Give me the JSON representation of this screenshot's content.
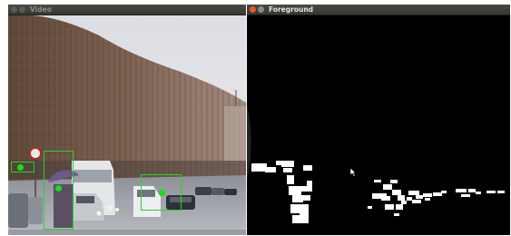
{
  "windows": {
    "video": {
      "title": "Video",
      "title_color": "#8f8d86",
      "close_color": "#5c5b55",
      "min_color": "#5c5b55"
    },
    "foreground": {
      "title": "Foreground",
      "title_color": "#e6e4df",
      "close_color": "#e9542a",
      "min_color": "#8d8b85"
    }
  },
  "icons": {
    "close": "close-icon",
    "minimize": "minimize-icon",
    "cursor": "mouse-pointer-icon"
  },
  "colors": {
    "detection_box": "#2bd12b",
    "centroid": "#14e014",
    "mask_background": "#000000",
    "mask_foreground": "#ffffff"
  }
}
